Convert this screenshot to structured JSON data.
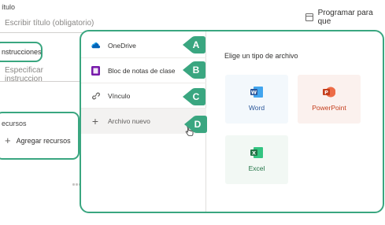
{
  "form": {
    "title_label": "ítulo",
    "title_placeholder": "Escribir título (obligatorio)",
    "instructions_label": "nstrucciones",
    "instructions_placeholder": "Especificar instruccion",
    "resources_label": "ecursos",
    "add_resources": "Agregar recursos"
  },
  "schedule": {
    "label": "Programar para que"
  },
  "menu": {
    "items": [
      {
        "label": "OneDrive",
        "badge": "A",
        "icon": "onedrive-icon",
        "color": "#0364b8"
      },
      {
        "label": "Bloc de notas de clase",
        "badge": "B",
        "icon": "onenote-icon",
        "color": "#7719aa"
      },
      {
        "label": "Vínculo",
        "badge": "C",
        "icon": "link-icon",
        "color": "#605e5c"
      },
      {
        "label": "Archivo nuevo",
        "badge": "D",
        "icon": "plus-icon",
        "color": "#605e5c"
      }
    ]
  },
  "file_types": {
    "title": "Elige un tipo de archivo",
    "items": [
      {
        "label": "Word",
        "letter": "W",
        "icon": "word-icon",
        "color": "#2b579a"
      },
      {
        "label": "PowerPoint",
        "letter": "P",
        "icon": "powerpoint-icon",
        "color": "#c43e1c"
      },
      {
        "label": "Excel",
        "letter": "X",
        "icon": "excel-icon",
        "color": "#217346"
      }
    ]
  },
  "colors": {
    "accent": "#3aa680",
    "hover_bg": "#f3f2f1"
  }
}
